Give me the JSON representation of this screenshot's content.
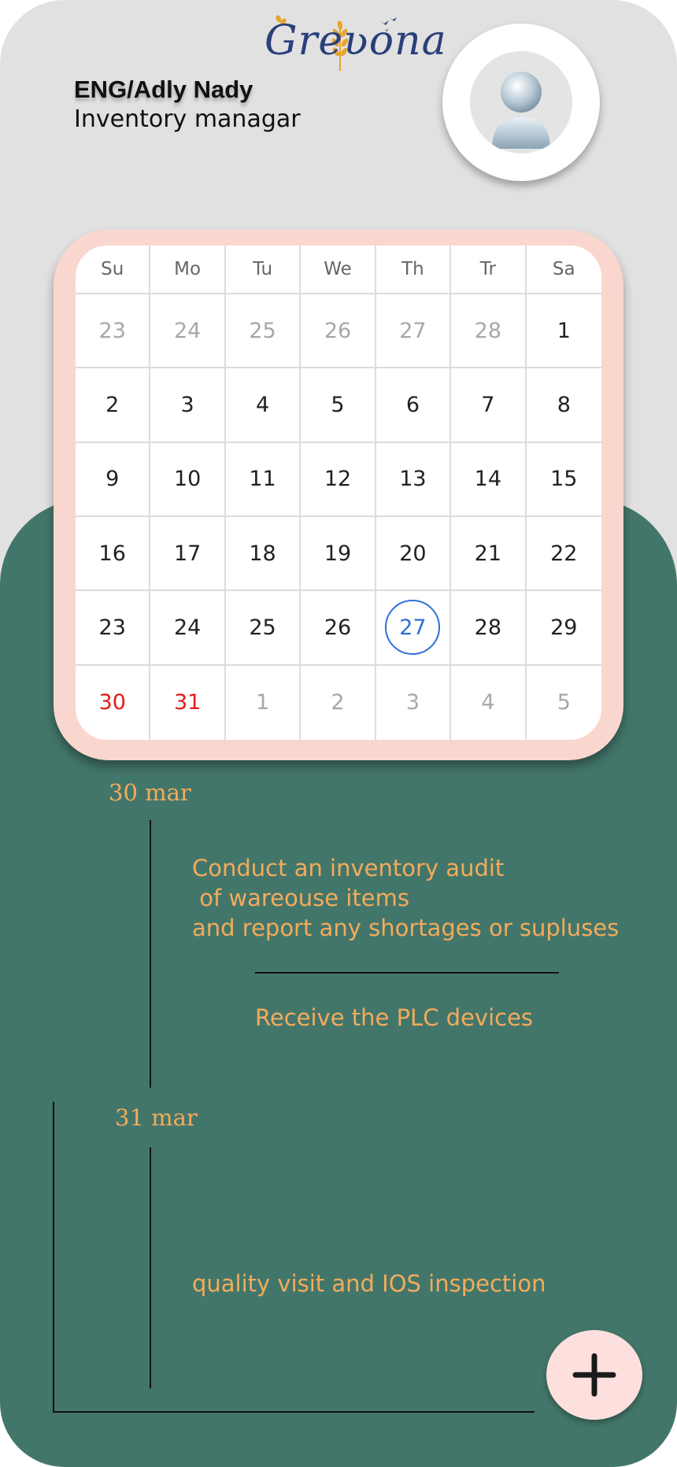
{
  "header": {
    "logo_text": "Greʋona",
    "user_name": "ENG/Adly Nady",
    "user_role": "Inventory managar",
    "avatar_icon": "user-avatar-icon"
  },
  "calendar": {
    "weekdays": [
      "Su",
      "Mo",
      "Tu",
      "We",
      "Th",
      "Tr",
      "Sa"
    ],
    "weeks": [
      [
        "23",
        "24",
        "25",
        "26",
        "27",
        "28",
        "1"
      ],
      [
        "2",
        "3",
        "4",
        "5",
        "6",
        "7",
        "8"
      ],
      [
        "9",
        "10",
        "11",
        "12",
        "13",
        "14",
        "15"
      ],
      [
        "16",
        "17",
        "18",
        "19",
        "20",
        "21",
        "22"
      ],
      [
        "23",
        "24",
        "25",
        "26",
        "27",
        "28",
        "29"
      ],
      [
        "30",
        "31",
        "1",
        "2",
        "3",
        "4",
        "5"
      ]
    ],
    "selected_day": "27",
    "highlighted_days": [
      "30",
      "31"
    ],
    "colors": {
      "selected": "#2f6fd8",
      "highlight": "#e81919",
      "muted": "#a8a8a8"
    }
  },
  "agenda": [
    {
      "date": "30 mar",
      "tasks": [
        "Conduct an inventory audit\n of wareouse items\nand report any shortages or supluses",
        "Receive the PLC devices"
      ]
    },
    {
      "date": "31 mar",
      "tasks": [
        "quality visit and IOS inspection"
      ]
    }
  ],
  "add_button": {
    "icon": "plus-icon"
  },
  "colors": {
    "top_background": "#e1e1e1",
    "bottom_background": "#43766a",
    "calendar_frame": "#f9d7cf",
    "accent_text": "#f3ab5b",
    "add_button": "#fde0dd"
  }
}
